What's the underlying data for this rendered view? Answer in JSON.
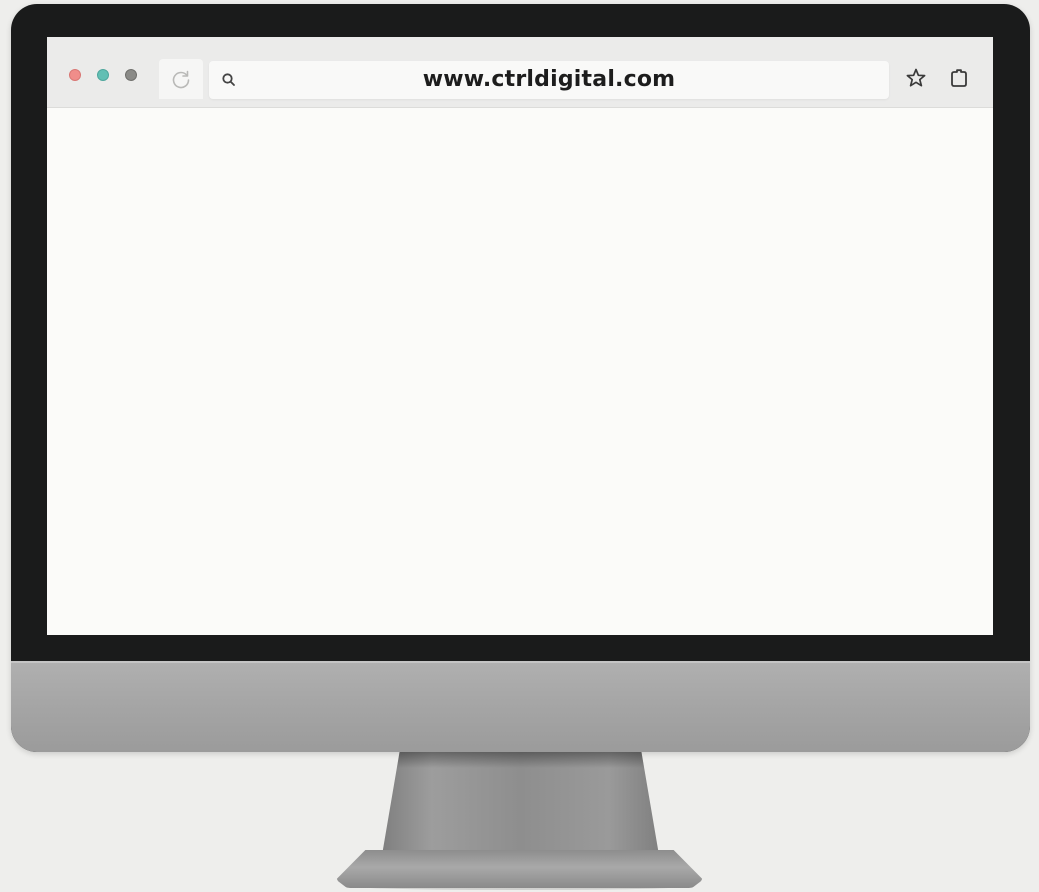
{
  "browser": {
    "url": "www.ctrldigital.com",
    "window_controls": [
      "close",
      "minimize",
      "maximize"
    ],
    "icons": {
      "reload": "reload-icon",
      "search": "search-icon",
      "bookmark": "star-icon",
      "extension": "extension-icon"
    }
  },
  "colors": {
    "bezel": "#1a1b1b",
    "chin": "#a6a6a6",
    "screen": "#fafaf8",
    "toolbar": "#ebebea",
    "close_dot": "#f08d8a",
    "minimize_dot": "#62bfb4",
    "maximize_dot": "#8a8a87",
    "url_text": "#1d1d1d"
  }
}
